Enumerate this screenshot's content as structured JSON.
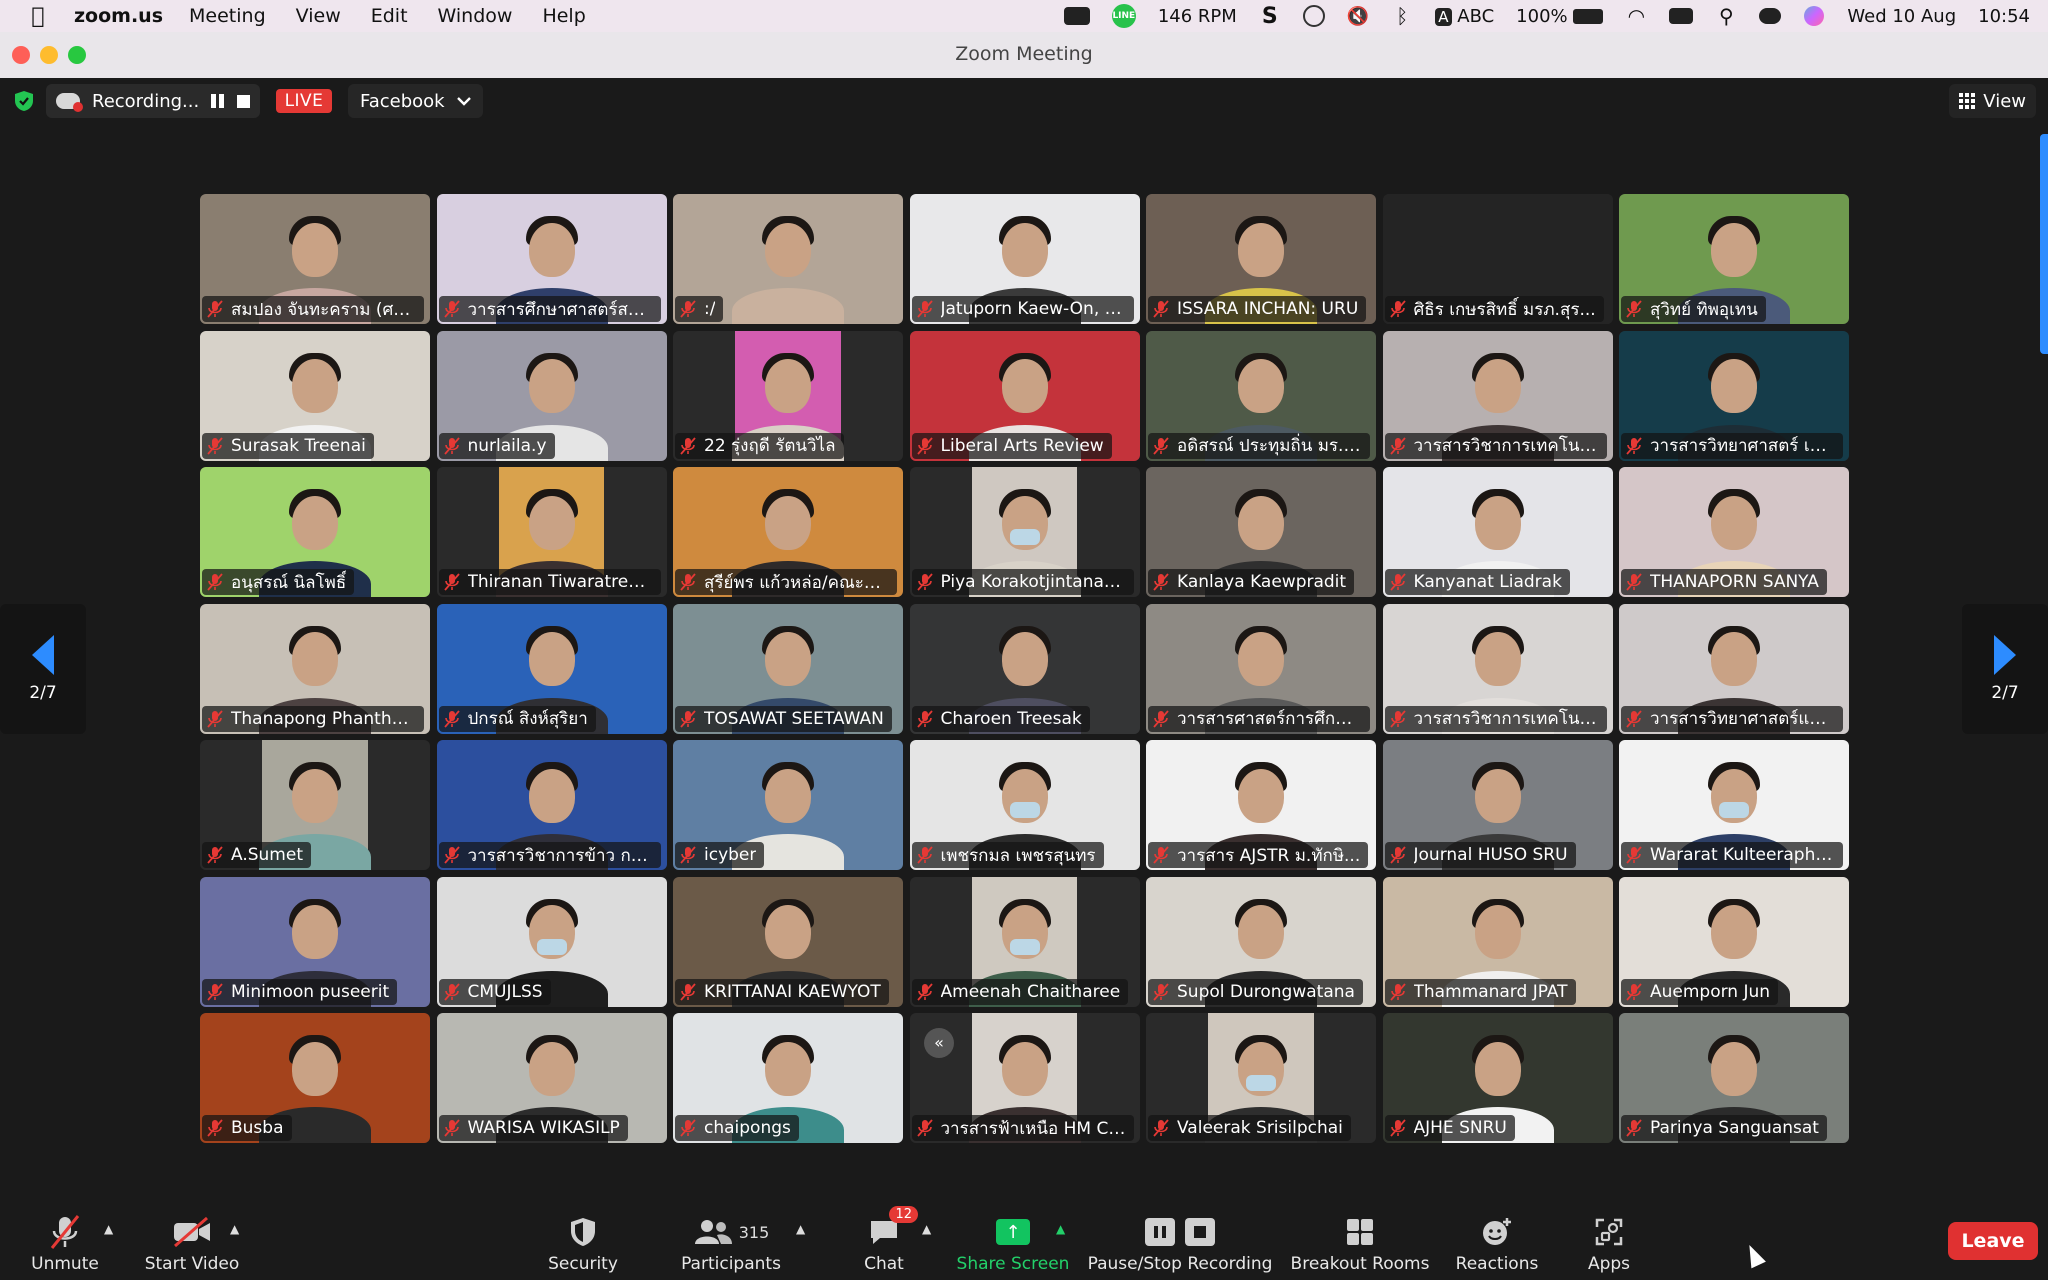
{
  "menubar": {
    "app_name": "zoom.us",
    "menus": [
      "Meeting",
      "View",
      "Edit",
      "Window",
      "Help"
    ],
    "rpm_value": "146",
    "rpm_unit": "RPM",
    "input_source": "ABC",
    "battery": "100%",
    "date": "Wed 10 Aug",
    "time": "10:54"
  },
  "window": {
    "title": "Zoom Meeting"
  },
  "topbar": {
    "recording_label": "Recording...",
    "live_label": "LIVE",
    "stream_target": "Facebook",
    "view_label": "View"
  },
  "pager": {
    "page": "2/7"
  },
  "participants": [
    {
      "name": "สมปอง จันทะคราม (ศรี...",
      "bg": "#8a7e70",
      "shirt": "#c7a7a0",
      "hair": true
    },
    {
      "name": "วารสารศึกษาศาสตร์สาร...",
      "bg": "#d8cfe0",
      "shirt": "#2f3f6a",
      "hair": true
    },
    {
      "name": ":/",
      "bg": "#b3a597",
      "shirt": "#c9b19e",
      "hair": true
    },
    {
      "name": "Jatuporn Kaew-On, A...",
      "bg": "#e8e8ea",
      "shirt": "#3a3a3a",
      "hair": true
    },
    {
      "name": "ISSARA INCHAN: URU",
      "bg": "#6d5f54",
      "shirt": "#d8c34a",
      "hair": true
    },
    {
      "name": "ศิธิร เกษรสิทธิ์ มรภ.สุร...",
      "bg": "#242424",
      "shirt": "",
      "hair": false
    },
    {
      "name": "สุวิทย์ ทิพอุเทน",
      "bg": "#6f9a4f",
      "shirt": "#4b5a7a",
      "hair": true
    },
    {
      "name": "Surasak Treenai",
      "bg": "#d7d2c9",
      "shirt": "#f2f2f2",
      "hair": true
    },
    {
      "name": "nurlaila.y",
      "bg": "#9b9aa6",
      "shirt": "#e5e5e5",
      "hair": true
    },
    {
      "name": "22 รุ่งฤดี รัตนวิไล",
      "bg": "#d35db0",
      "shirt": "#d9d0c6",
      "hair": true,
      "narrow": true
    },
    {
      "name": "Liberal Arts Review",
      "bg": "#c4333b",
      "shirt": "#e9e3e1",
      "hair": true
    },
    {
      "name": "อดิสรณ์ ประทุมถิ่น มร.ชร.",
      "bg": "#4f5a48",
      "shirt": "#4d5a62",
      "hair": true
    },
    {
      "name": "วารสารวิชาการเทคโนโ...",
      "bg": "#b7b0b0",
      "shirt": "#3e3535",
      "hair": true
    },
    {
      "name": "วารสารวิทยาศาสตร์ เท...",
      "bg": "#153c4a",
      "shirt": "#1d2d36",
      "hair": true
    },
    {
      "name": "อนุสรณ์ นิลโพธิ์",
      "bg": "#9fd36b",
      "shirt": "#1f2f4a",
      "hair": true
    },
    {
      "name": "Thiranan Tiwaratreewit",
      "bg": "#d9a24d",
      "shirt": "#3a3030",
      "hair": true,
      "narrow": true
    },
    {
      "name": "สุรีย์พร แก้วหล่อ/คณะวิท...",
      "bg": "#cf8a3e",
      "shirt": "#2e2a2a",
      "hair": true
    },
    {
      "name": "Piya Korakotjintanaka...",
      "bg": "#cfc8c1",
      "shirt": "#d8d2c8",
      "hair": true,
      "narrow": true,
      "mask": true
    },
    {
      "name": "Kanlaya Kaewpradit",
      "bg": "#6b655f",
      "shirt": "#2f2f2f",
      "hair": true
    },
    {
      "name": "Kanyanat Liadrak",
      "bg": "#e4e4e8",
      "shirt": "#f1f1f1",
      "hair": true
    },
    {
      "name": "THANAPORN SANYA",
      "bg": "#d5c6c8",
      "shirt": "#e8d4b8",
      "hair": true
    },
    {
      "name": "Thanapong Phanthong",
      "bg": "#c7c0b6",
      "shirt": "#4d4242",
      "hair": true
    },
    {
      "name": "ปกรณ์ สิงห์สุริยา",
      "bg": "#2a62b8",
      "shirt": "#2f2f34",
      "hair": true
    },
    {
      "name": "TOSAWAT SEETAWAN",
      "bg": "#7d8f93",
      "shirt": "#344a6a",
      "hair": true
    },
    {
      "name": "Charoen Treesak",
      "bg": "#343536",
      "shirt": "#4e4e60",
      "hair": true
    },
    {
      "name": "วารสารศาสตร์การศึกษา...",
      "bg": "#8e8a84",
      "shirt": "#5a5a5a",
      "hair": true
    },
    {
      "name": "วารสารวิชาการเทคโนโ...",
      "bg": "#d8d5d3",
      "shirt": "#e2dedb",
      "hair": true
    },
    {
      "name": "วารสารวิทยาศาสตร์และ...",
      "bg": "#cfcaca",
      "shirt": "#3b3434",
      "hair": true
    },
    {
      "name": "A.Sumet",
      "bg": "#a9a79c",
      "shirt": "#7aa7a3",
      "hair": true,
      "narrow": true
    },
    {
      "name": "วารสารวิชาการข้าว กรม...",
      "bg": "#2c4f9e",
      "shirt": "#2f2f3a",
      "hair": true
    },
    {
      "name": "icyber",
      "bg": "#5f7fa3",
      "shirt": "#e5e4df",
      "hair": true
    },
    {
      "name": "เพชรกมล เพชรสุนทร",
      "bg": "#e5e5e5",
      "shirt": "#2b2b2b",
      "hair": true,
      "mask": true
    },
    {
      "name": "วารสาร AJSTR ม.ทักษิ...",
      "bg": "#f1f1f1",
      "shirt": "#3a2f2f",
      "hair": true
    },
    {
      "name": "Journal HUSO SRU",
      "bg": "#7b7e82",
      "shirt": "#3a3a3a",
      "hair": true
    },
    {
      "name": "Wararat Kulteerapho...",
      "bg": "#f2f2f2",
      "shirt": "#2d3f66",
      "hair": true,
      "mask": true
    },
    {
      "name": "Minimoon puseerit",
      "bg": "#6a6fa2",
      "shirt": "#2e2e3b",
      "hair": true
    },
    {
      "name": "CMUJLSS",
      "bg": "#dcdcdc",
      "shirt": "#1e1e1e",
      "hair": true,
      "mask": true
    },
    {
      "name": "KRITTANAI KAEWYOT",
      "bg": "#6b5a48",
      "shirt": "#2d2d2d",
      "hair": true
    },
    {
      "name": "Ameenah Chaitharee",
      "bg": "#cfc9c0",
      "shirt": "#3e5e4a",
      "hair": true,
      "narrow": true,
      "mask": true
    },
    {
      "name": "Supol Durongwatana",
      "bg": "#d8d4cd",
      "shirt": "#2a2a2a",
      "hair": true
    },
    {
      "name": "Thammanard JPAT",
      "bg": "#c9b9a4",
      "shirt": "#f0efee",
      "hair": true
    },
    {
      "name": "Auemporn Jun",
      "bg": "#e3ded8",
      "shirt": "#2a2a2a",
      "hair": true
    },
    {
      "name": "Busba",
      "bg": "#a4431c",
      "shirt": "#2a2a2a",
      "hair": true
    },
    {
      "name": "WARISA WIKASILP",
      "bg": "#b8b8b2",
      "shirt": "#2c2c2c",
      "hair": true
    },
    {
      "name": "chaipongs",
      "bg": "#e0e3e5",
      "shirt": "#3d8d8b",
      "hair": true
    },
    {
      "name": "วารสารฟ้าเหนือ HM CR...",
      "bg": "#d7d2cc",
      "shirt": "#3a3030",
      "hair": true,
      "narrow": true
    },
    {
      "name": "Valeerak Srisilpchai",
      "bg": "#cfc7bd",
      "shirt": "#2e2e2e",
      "hair": true,
      "narrow": true,
      "mask": true
    },
    {
      "name": "AJHE SNRU",
      "bg": "#33372f",
      "shirt": "#f2f2f2",
      "hair": true
    },
    {
      "name": "Parinya Sanguansat",
      "bg": "#7a7f7a",
      "shirt": "#2b2b2b",
      "hair": true
    }
  ],
  "toolbar": {
    "unmute": "Unmute",
    "start_video": "Start Video",
    "security": "Security",
    "participants": "Participants",
    "participant_count": "315",
    "chat": "Chat",
    "chat_badge": "12",
    "share_screen": "Share Screen",
    "pause_stop_recording": "Pause/Stop Recording",
    "breakout_rooms": "Breakout Rooms",
    "reactions": "Reactions",
    "apps": "Apps",
    "leave": "Leave"
  },
  "colors": {
    "accent_blue": "#2d8cff",
    "live_red": "#e53935",
    "share_green": "#12c460",
    "leave_red": "#e03131"
  }
}
